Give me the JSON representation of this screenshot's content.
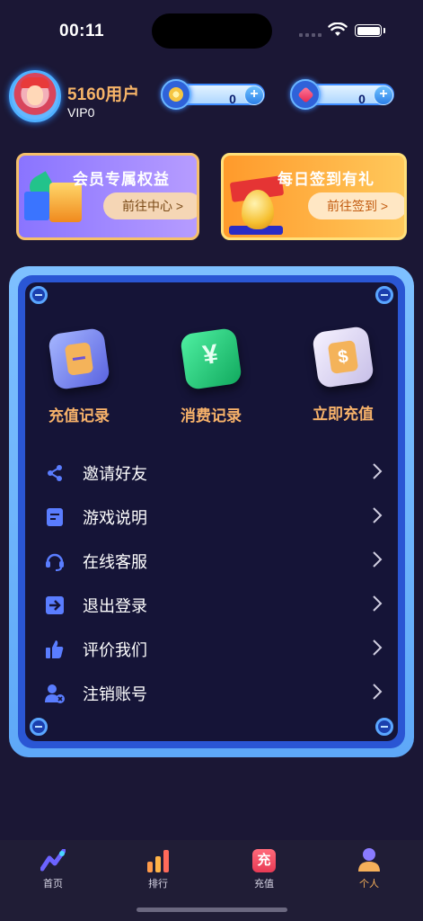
{
  "status_bar": {
    "time": "00:11"
  },
  "profile": {
    "username": "5160用户",
    "vip_level": "VIP0"
  },
  "currencies": [
    {
      "icon": "coin-icon",
      "value": "0"
    },
    {
      "icon": "gem-icon",
      "value": "0"
    }
  ],
  "promo": {
    "vip_card": {
      "title": "会员专属权益",
      "button": "前往中心 >"
    },
    "sign_card": {
      "title": "每日签到有礼",
      "button": "前往签到 >"
    }
  },
  "features": [
    {
      "label": "充值记录",
      "icon": "recharge-record-icon"
    },
    {
      "label": "消费记录",
      "icon": "yen-icon"
    },
    {
      "label": "立即充值",
      "icon": "dollar-wallet-icon"
    }
  ],
  "menu": [
    {
      "label": "邀请好友",
      "icon": "share-icon"
    },
    {
      "label": "游戏说明",
      "icon": "document-icon"
    },
    {
      "label": "在线客服",
      "icon": "headset-icon"
    },
    {
      "label": "退出登录",
      "icon": "logout-icon"
    },
    {
      "label": "评价我们",
      "icon": "thumbs-up-icon"
    },
    {
      "label": "注销账号",
      "icon": "delete-account-icon"
    }
  ],
  "tabs": [
    {
      "label": "首页",
      "icon": "home-chart-icon"
    },
    {
      "label": "排行",
      "icon": "ranking-bars-icon"
    },
    {
      "label": "充值",
      "icon": "recharge-icon",
      "icon_text": "充"
    },
    {
      "label": "个人",
      "icon": "person-icon",
      "active": true
    }
  ],
  "colors": {
    "accent": "#f6b05a",
    "background": "#1b1735",
    "panel_border": "#7ec0ff"
  }
}
